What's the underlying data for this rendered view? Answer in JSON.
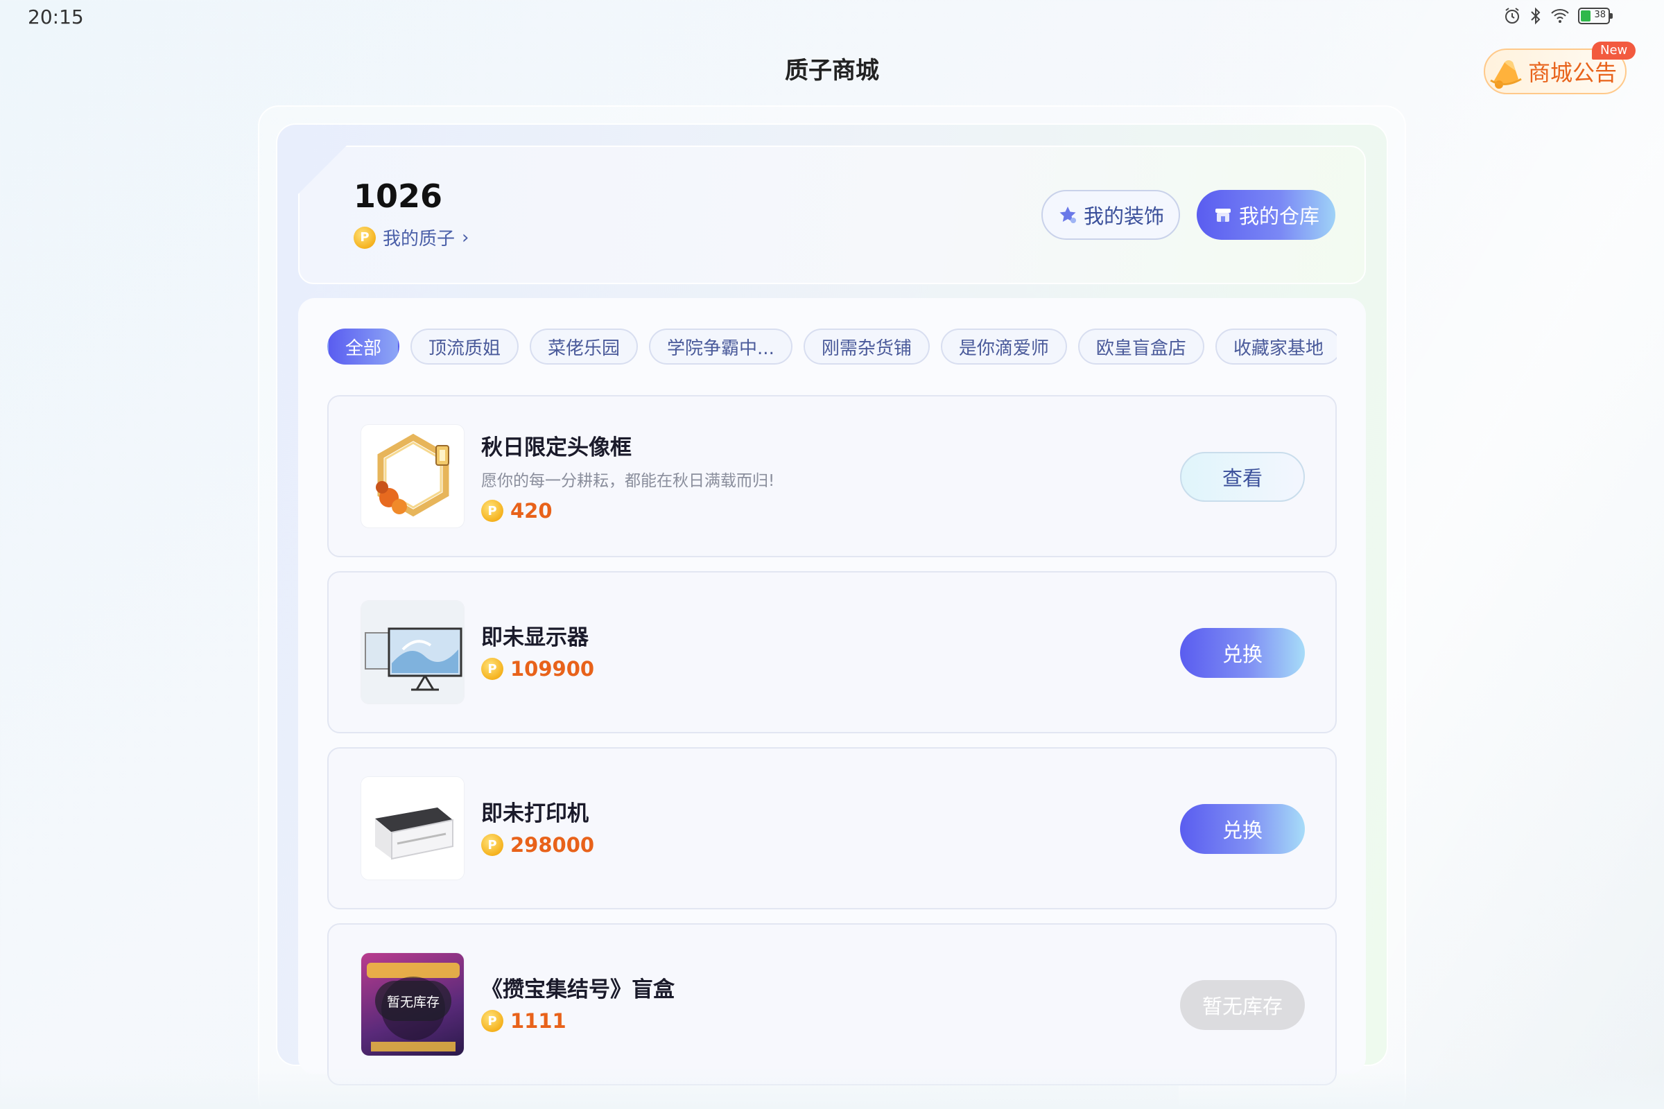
{
  "status_bar": {
    "time": "20:15",
    "battery_level": "38",
    "battery_fraction": 0.38
  },
  "header": {
    "title": "质子商城",
    "notice_label": "商城公告",
    "new_badge": "New"
  },
  "account": {
    "points": "1026",
    "my_points_label": "我的质子",
    "decor_button": "我的装饰",
    "warehouse_button": "我的仓库"
  },
  "tabs": [
    {
      "label": "全部",
      "active": true
    },
    {
      "label": "顶流质姐",
      "active": false
    },
    {
      "label": "菜佬乐园",
      "active": false
    },
    {
      "label": "学院争霸中...",
      "active": false
    },
    {
      "label": "刚需杂货铺",
      "active": false
    },
    {
      "label": "是你滴爱师",
      "active": false
    },
    {
      "label": "欧皇盲盒店",
      "active": false
    },
    {
      "label": "收藏家基地",
      "active": false
    }
  ],
  "products": [
    {
      "title": "秋日限定头像框",
      "desc": "愿你的每一分耕耘，都能在秋日满载而归!",
      "price": "420",
      "action": "查看",
      "action_type": "view"
    },
    {
      "title": "即未显示器",
      "desc": "",
      "price": "109900",
      "action": "兑换",
      "action_type": "redeem"
    },
    {
      "title": "即未打印机",
      "desc": "",
      "price": "298000",
      "action": "兑换",
      "action_type": "redeem"
    },
    {
      "title": "《攒宝集结号》盲盒",
      "desc": "",
      "price": "1111",
      "action": "暂无库存",
      "action_type": "out_of_stock",
      "thumb_overlay": "暂无库存"
    }
  ],
  "colors": {
    "accent": "#5a5df0",
    "price": "#e8621a",
    "notice": "#e8621a"
  },
  "icons": {
    "coin": "coin-icon",
    "decor": "star-decor-icon",
    "warehouse": "store-icon",
    "notice": "bell-icon"
  }
}
